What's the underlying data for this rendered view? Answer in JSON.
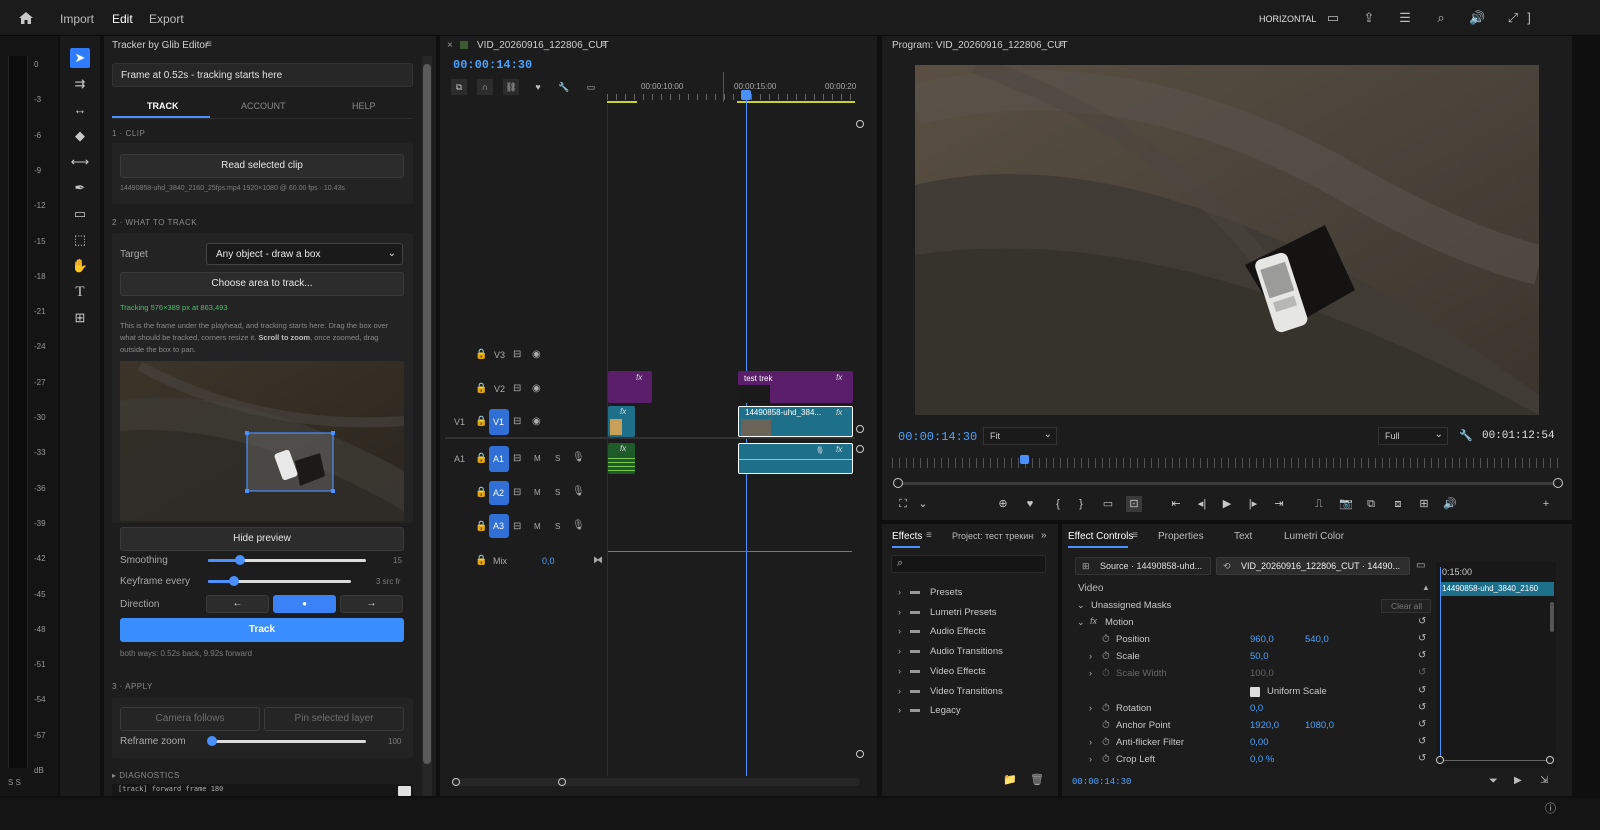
{
  "menu": {
    "import": "Import",
    "edit": "Edit",
    "export": "Export",
    "workspace": "HORIZONTAL"
  },
  "meter": {
    "ticks": [
      "0",
      "-3",
      "-6",
      "-9",
      "-12",
      "-15",
      "-18",
      "-21",
      "-24",
      "-27",
      "-30",
      "-33",
      "-36",
      "-39",
      "-42",
      "-45",
      "-48",
      "-51",
      "-54",
      "-57",
      "dB"
    ],
    "footer": "S S"
  },
  "tracker": {
    "title": "Tracker by Glib Editor",
    "status": "Frame at 0.52s - tracking starts here",
    "tabs": [
      "TRACK",
      "ACCOUNT",
      "HELP"
    ],
    "section1": "1 · CLIP",
    "read_btn": "Read selected clip",
    "clip_info": "14490858-uhd_3840_2160_25fps.mp4  1920×1080 @ 60.00 fps · 10.43s",
    "section2": "2 · WHAT TO TRACK",
    "target_label": "Target",
    "target_value": "Any object - draw a box",
    "choose_btn": "Choose area to track...",
    "tracking_info": "Tracking 576×389 px at 863,493",
    "help_text_a": "This is the frame under the playhead, and tracking starts here. Drag the box over what should be tracked, corners resize it.",
    "help_text_bold": "Scroll to zoom",
    "help_text_b": ", once zoomed, drag outside the box to pan.",
    "hide_btn": "Hide preview",
    "smoothing_label": "Smoothing",
    "smoothing_value": "15",
    "smoothing_level": 0.2,
    "keyframe_label": "Keyframe every",
    "keyframe_value": "3 src fr",
    "keyframe_level": 0.18,
    "direction_label": "Direction",
    "dir_back": "←",
    "dir_both": "●",
    "dir_fwd": "→",
    "track_btn": "Track",
    "track_info": "both ways: 0.52s back, 9.92s forward",
    "section3": "3 · APPLY",
    "camera_btn": "Camera follows",
    "pin_btn": "Pin selected layer",
    "reframe_label": "Reframe zoom",
    "reframe_value": "100",
    "reframe_level": 0.0,
    "diagnostics": "▸ DIAGNOSTICS",
    "log": "[track] forward frame 180"
  },
  "timeline": {
    "close": "×",
    "title": "VID_20260916_122806_CUT",
    "timecode": "00:00:14:30",
    "ruler": [
      "00:00:10:00",
      "00:00:15:00",
      "00:00:20"
    ],
    "tracks": [
      {
        "id": "V3",
        "lock": true
      },
      {
        "id": "V2"
      },
      {
        "id": "V1"
      },
      {
        "id": "A1"
      },
      {
        "id": "A2"
      },
      {
        "id": "A3"
      }
    ],
    "src_v1": "V1",
    "src_a1": "A1",
    "mute": "M",
    "solo": "S",
    "mix_label": "Mix",
    "mix_value": "0,0",
    "clip_text_title": "test trek",
    "clip_video": "14490858-uhd_384...",
    "fx": "fx"
  },
  "program": {
    "title": "Program: VID_20260916_122806_CUT",
    "timecode": "00:00:14:30",
    "fit": "Fit",
    "quality": "Full",
    "duration": "00:01:12:54"
  },
  "effects": {
    "tab": "Effects",
    "project_tab": "Project: тест трекинг",
    "items": [
      "Presets",
      "Lumetri Presets",
      "Audio Effects",
      "Audio Transitions",
      "Video Effects",
      "Video Transitions",
      "Legacy"
    ]
  },
  "effect_controls": {
    "tabs": [
      "Effect Controls",
      "Properties",
      "Text",
      "Lumetri Color"
    ],
    "source": "Source · 14490858-uhd...",
    "sequence": "VID_20260916_122806_CUT · 14490...",
    "mini_time": "0:15:00",
    "mini_clip": "14490858-uhd_3840_2160",
    "video_label": "Video",
    "masks_label": "Unassigned Masks",
    "clear_all": "Clear all",
    "motion_label": "Motion",
    "params": [
      {
        "name": "Position",
        "v1": "960,0",
        "v2": "540,0"
      },
      {
        "name": "Scale",
        "v1": "50,0",
        "v2": ""
      },
      {
        "name": "Scale Width",
        "v1": "100,0",
        "v2": ""
      },
      {
        "name": "Uniform Scale",
        "v1": "",
        "v2": ""
      },
      {
        "name": "Rotation",
        "v1": "0,0",
        "v2": ""
      },
      {
        "name": "Anchor Point",
        "v1": "1920,0",
        "v2": "1080,0"
      },
      {
        "name": "Anti-flicker Filter",
        "v1": "0,00",
        "v2": ""
      },
      {
        "name": "Crop Left",
        "v1": "0,0 %",
        "v2": ""
      }
    ],
    "footer_time": "00:00:14:30"
  }
}
